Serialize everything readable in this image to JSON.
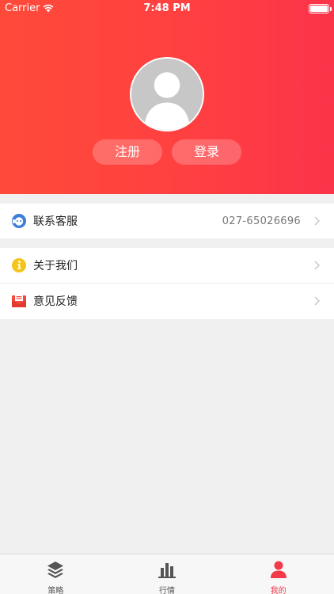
{
  "status_bar": {
    "carrier": "Carrier",
    "time": "7:48 PM"
  },
  "profile": {
    "register_label": "注册",
    "login_label": "登录"
  },
  "menu": {
    "contact": {
      "label": "联系客服",
      "value": "027-65026696",
      "icon": "customer-service-icon"
    },
    "about": {
      "label": "关于我们",
      "icon": "info-icon"
    },
    "feedback": {
      "label": "意见反馈",
      "icon": "mail-icon"
    }
  },
  "tabbar": {
    "tabs": [
      {
        "label": "策略",
        "icon": "layers-icon",
        "active": false
      },
      {
        "label": "行情",
        "icon": "bar-chart-icon",
        "active": false
      },
      {
        "label": "我的",
        "icon": "person-icon",
        "active": true
      }
    ]
  },
  "colors": {
    "accent": "#f23a4a",
    "header_start": "#ff4a3a",
    "header_end": "#fb344a"
  }
}
